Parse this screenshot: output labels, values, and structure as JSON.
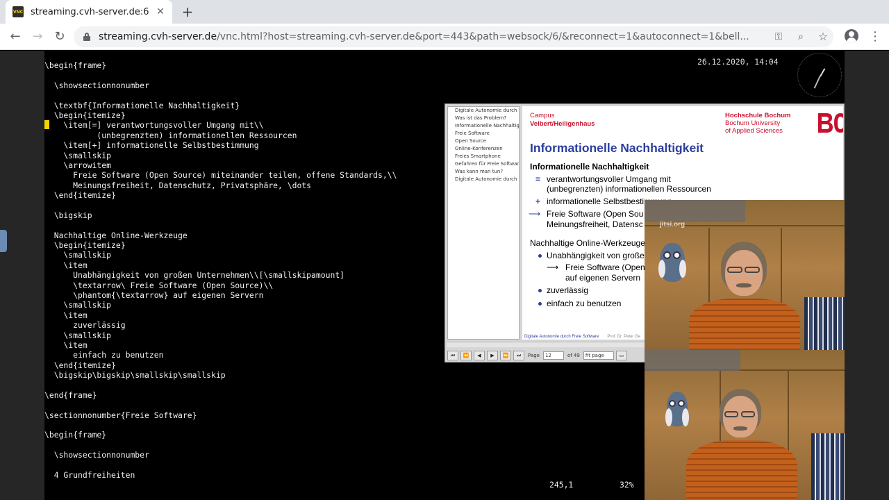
{
  "browser": {
    "tab_title": "streaming.cvh-server.de:6",
    "favicon_text": "VNC",
    "url_host": "streaming.cvh-server.de",
    "url_rest": "/vnc.html?host=streaming.cvh-server.de&port=443&path=websock/6/&reconnect=1&autoconnect=1&bell...",
    "icons": [
      "back-icon",
      "forward-icon",
      "reload-icon",
      "lock-icon",
      "key-icon",
      "zoom-icon",
      "star-icon",
      "profile-icon",
      "menu-icon"
    ]
  },
  "desktop": {
    "datetime": "26.12.2020, 14:04",
    "status_position": "245,1",
    "status_percent": "32%"
  },
  "terminal_lines": [
    "\\begin{frame}",
    "",
    "  \\showsectionnonumber",
    "",
    "  \\textbf{Informationelle Nachhaltigkeit}",
    "  \\begin{itemize}",
    "    \\item[=] verantwortungsvoller Umgang mit\\\\",
    "           (unbegrenzten) informationellen Ressourcen",
    "    \\item[+] informationelle Selbstbestimmung",
    "    \\smallskip",
    "    \\arrowitem",
    "      Freie Software (Open Source) miteinander teilen, offene Standards,\\\\",
    "      Meinungsfreiheit, Datenschutz, Privatsphäre, \\dots",
    "  \\end{itemize}",
    "",
    "  \\bigskip",
    "",
    "  Nachhaltige Online-Werkzeuge",
    "  \\begin{itemize}",
    "    \\smallskip",
    "    \\item",
    "      Unabhängigkeit von großen Unternehmen\\\\[\\smallskipamount]",
    "      \\textarrow\\ Freie Software (Open Source)\\\\",
    "      \\phantom{\\textarrow} auf eigenen Servern",
    "    \\smallskip",
    "    \\item",
    "      zuverlässig",
    "    \\smallskip",
    "    \\item",
    "      einfach zu benutzen",
    "  \\end{itemize}",
    "  \\bigskip\\bigskip\\smallskip\\smallskip",
    "",
    "\\end{frame}",
    "",
    "\\sectionnonumber{Freie Software}",
    "",
    "\\begin{frame}",
    "",
    "  \\showsectionnonumber",
    "",
    "  4 Grundfreiheiten"
  ],
  "pdf": {
    "outline": [
      "Digitale Autonomie durch F",
      "Was ist das Problem?",
      "Informationelle Nachhaltigk",
      "Freie Software",
      "Open Source",
      "Online-Konferenzen",
      "Freies Smartphone",
      "Gefahren für Freie Software",
      "Was kann man tun?",
      "Digitale Autonomie durch F"
    ],
    "slide": {
      "campus_line1": "Campus",
      "campus_line2": "Velbert/Heiligenhaus",
      "hs_line1": "Hochschule Bochum",
      "hs_line2": "Bochum University",
      "hs_line3": "of Applied Sciences",
      "title": "Informationelle Nachhaltigkeit",
      "heading1": "Informationelle Nachhaltigkeit",
      "item1_mark": "=",
      "item1_line1": "verantwortungsvoller Umgang mit",
      "item1_line2": "(unbegrenzten) informationellen Ressourcen",
      "item2_mark": "+",
      "item2": "informationelle Selbstbestimmung",
      "item3_mark": "⟶",
      "item3_line1": "Freie Software (Open Sou",
      "item3_line2": "Meinungsfreiheit, Datensc",
      "heading2": "Nachhaltige Online-Werkzeuge",
      "b1": "Unabhängigkeit von große",
      "b1_sub_arrow": "⟶",
      "b1_sub1": "Freie Software (Open",
      "b1_sub2": "auf eigenen Servern",
      "b2": "zuverlässig",
      "b3": "einfach zu benutzen",
      "footer": "Digitale Autonomie durch Freie Software",
      "footer_author": "Prof. Dr. Peter Ge"
    },
    "nav": {
      "page_label": "Page",
      "page_value": "12",
      "of_label": "of 49",
      "zoom_value": "fit page"
    }
  },
  "video": {
    "watermark": "jitsi.org"
  }
}
